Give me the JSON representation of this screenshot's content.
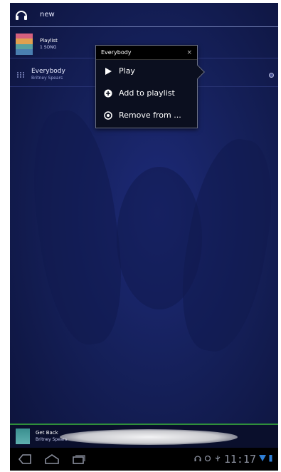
{
  "actionbar": {
    "title": "new",
    "icon": "headphones-icon"
  },
  "playlist_row": {
    "title": "Playlist",
    "subtitle": "1 SONG"
  },
  "song_row": {
    "title": "Everybody",
    "artist": "Britney Spears"
  },
  "popup": {
    "title": "Everybody",
    "close": "×",
    "items": [
      {
        "label": "Play",
        "icon": "play-icon"
      },
      {
        "label": "Add to playlist",
        "icon": "add-icon"
      },
      {
        "label": "Remove from ...",
        "icon": "remove-icon"
      }
    ]
  },
  "now_playing": {
    "title": "Get Back",
    "artist": "Britney Spears"
  },
  "system_bar": {
    "clock": "11:17",
    "colors": {
      "signal": "#2f7fd6"
    }
  }
}
